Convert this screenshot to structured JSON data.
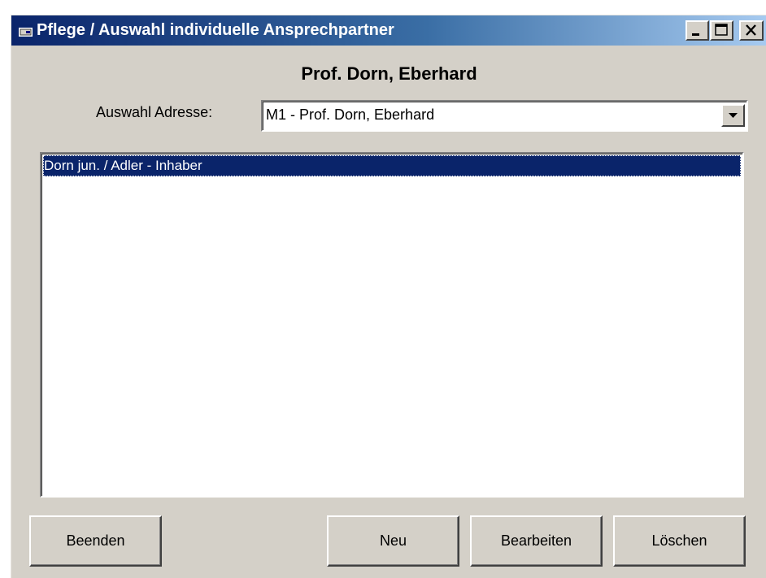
{
  "window": {
    "title": "Pflege / Auswahl individuelle Ansprechpartner",
    "minimize_glyph": "_",
    "maximize_glyph": "□",
    "close_glyph": "×"
  },
  "header": {
    "name": "Prof. Dorn, Eberhard"
  },
  "address_selector": {
    "label": "Auswahl Adresse:",
    "value": "M1 - Prof. Dorn, Eberhard"
  },
  "contacts_list": {
    "items": [
      {
        "label": "Dorn jun. / Adler - Inhaber",
        "selected": true
      }
    ]
  },
  "buttons": {
    "beenden": "Beenden",
    "neu": "Neu",
    "bearbeiten": "Bearbeiten",
    "loeschen": "Löschen"
  },
  "colors": {
    "title_start": "#0a246a",
    "title_end": "#a6caf0",
    "face": "#d4d0c8",
    "selection": "#0a246a"
  },
  "icons": {
    "title": "application-window-icon",
    "combo_arrow": "chevron-down-icon"
  }
}
